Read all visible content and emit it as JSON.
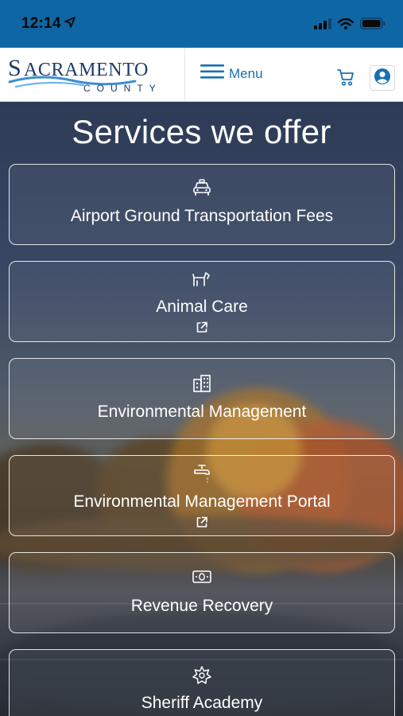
{
  "status_bar": {
    "time": "12:14"
  },
  "header": {
    "logo_text_1": "SACRAMENTO",
    "logo_text_2": "COUNTY",
    "menu_label": "Menu"
  },
  "page": {
    "title": "Services we offer"
  },
  "services": [
    {
      "label": "Airport Ground Transportation Fees",
      "icon": "taxi-icon",
      "external": false
    },
    {
      "label": "Animal Care",
      "icon": "dog-icon",
      "external": true
    },
    {
      "label": "Environmental Management",
      "icon": "building-icon",
      "external": false
    },
    {
      "label": "Environmental Management Portal",
      "icon": "faucet-icon",
      "external": true
    },
    {
      "label": "Revenue Recovery",
      "icon": "money-icon",
      "external": false
    },
    {
      "label": "Sheriff Academy",
      "icon": "badge-icon",
      "external": false
    }
  ],
  "colors": {
    "status_bar": "#0e66a5",
    "brand_blue": "#1a70b4",
    "card_border": "#ffffff"
  }
}
